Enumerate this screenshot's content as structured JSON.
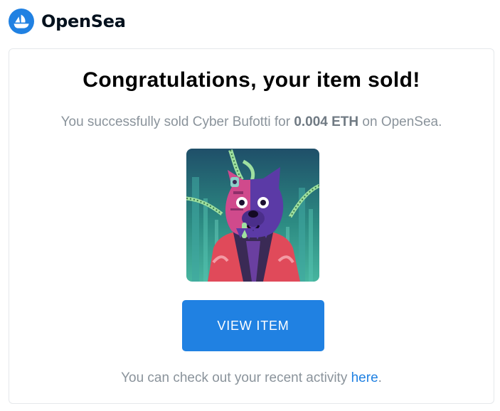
{
  "brand": {
    "name": "OpenSea",
    "logo_icon": "opensea-logo-icon",
    "accent_color": "#2081e2"
  },
  "email": {
    "title": "Congratulations, your item sold!",
    "message": {
      "prefix": "You successfully sold Cyber Bufotti for ",
      "price": "0.004 ETH",
      "suffix": " on OpenSea."
    },
    "item_image": {
      "icon": "nft-artwork-image",
      "item_name": "Cyber Bufotti"
    },
    "view_button_label": "VIEW ITEM",
    "footer": {
      "text": "You can check out your recent activity ",
      "link_label": "here",
      "end": "."
    }
  }
}
